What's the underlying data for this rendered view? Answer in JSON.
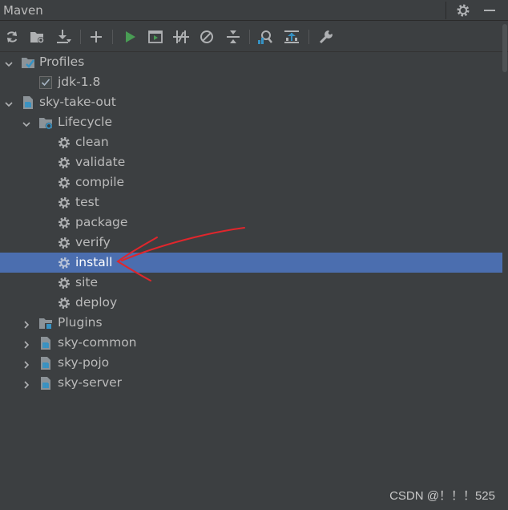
{
  "panel": {
    "title": "Maven"
  },
  "toolbar": {
    "buttons": [
      {
        "icon": "reload-icon"
      },
      {
        "icon": "generate-sources-icon"
      },
      {
        "icon": "download-sources-icon"
      },
      {
        "icon": "add-icon"
      },
      {
        "icon": "run-icon"
      },
      {
        "icon": "execute-goal-icon"
      },
      {
        "icon": "toggle-offline-icon"
      },
      {
        "icon": "skip-tests-icon"
      },
      {
        "icon": "collapse-all-icon"
      },
      {
        "icon": "analyze-dependencies-icon"
      },
      {
        "icon": "show-dependencies-icon"
      },
      {
        "icon": "settings-wrench-icon"
      }
    ]
  },
  "tree": {
    "profiles": {
      "label": "Profiles",
      "items": [
        {
          "label": "jdk-1.8",
          "checked": true
        }
      ]
    },
    "project": {
      "label": "sky-take-out",
      "lifecycle": {
        "label": "Lifecycle",
        "goals": [
          "clean",
          "validate",
          "compile",
          "test",
          "package",
          "verify",
          "install",
          "site",
          "deploy"
        ],
        "selected": "install"
      },
      "plugins": {
        "label": "Plugins"
      },
      "modules": [
        "sky-common",
        "sky-pojo",
        "sky-server"
      ]
    }
  },
  "watermark": "CSDN @！！！525",
  "colors": {
    "background": "#3c3f41",
    "selection": "#4b6eaf",
    "text": "#bbbbbb",
    "run_green": "#499c54",
    "maven_blue": "#3592c4",
    "annotation_red": "#e0262c"
  }
}
